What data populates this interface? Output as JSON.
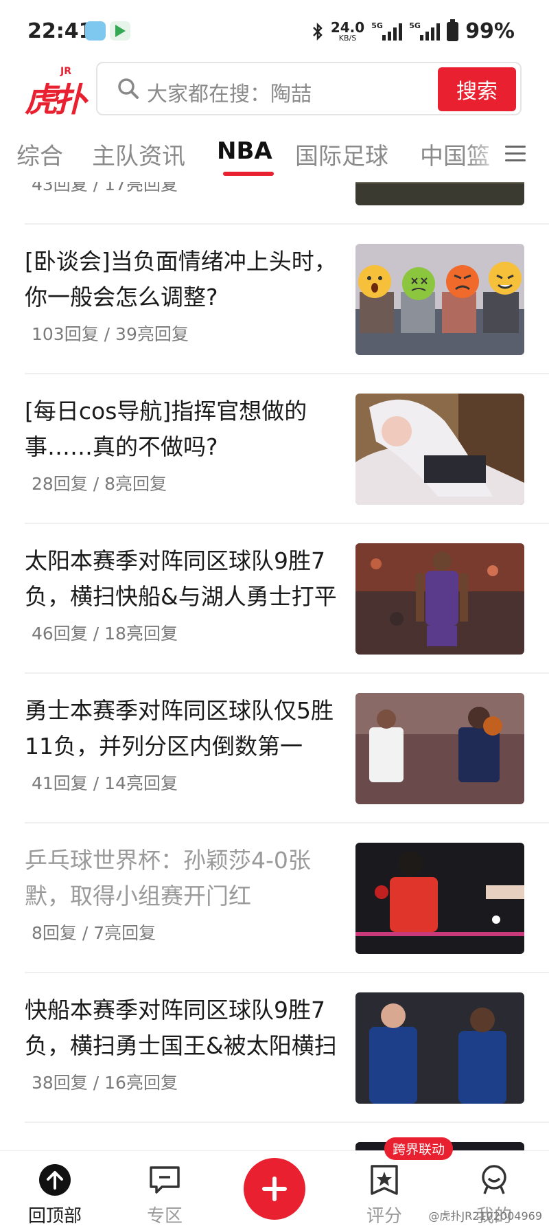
{
  "status_bar": {
    "time": "22:41",
    "net_speed_value": "24.0",
    "net_speed_unit": "KB/S",
    "sim1_label": "5G",
    "sim2_label": "5G",
    "battery": "99%"
  },
  "header": {
    "logo_text": "虎扑",
    "logo_sup": "JR",
    "search_placeholder": "大家都在搜：陶喆",
    "search_button": "搜索"
  },
  "tabs": [
    {
      "label": "综合",
      "active": false
    },
    {
      "label": "主队资讯",
      "active": false
    },
    {
      "label": "NBA",
      "active": true
    },
    {
      "label": "国际足球",
      "active": false
    },
    {
      "label": "中国篮",
      "active": false
    }
  ],
  "feed": {
    "partial_top": {
      "meta": "43回复 / 17亮回复"
    },
    "items": [
      {
        "title": "[卧谈会]当负面情绪冲上头时，你一般会怎么调整?",
        "meta": "103回复 / 39亮回复",
        "read": false,
        "thumb": "emoji-faces-image"
      },
      {
        "title": "[每日cos导航]指挥官想做的事……真的不做吗?",
        "meta": "28回复 / 8亮回复",
        "read": false,
        "thumb": "cosplay-image"
      },
      {
        "title": "太阳本赛季对阵同区球队9胜7负，横扫快船&与湖人勇士打平",
        "meta": "46回复 / 18亮回复",
        "read": false,
        "thumb": "suns-player-image"
      },
      {
        "title": "勇士本赛季对阵同区球队仅5胜11负，并列分区内倒数第一",
        "meta": "41回复 / 14亮回复",
        "read": false,
        "thumb": "warriors-clippers-image"
      },
      {
        "title": "乒乓球世界杯：孙颖莎4-0张默，取得小组赛开门红",
        "meta": "8回复 / 7亮回复",
        "read": true,
        "thumb": "table-tennis-image"
      },
      {
        "title": "快船本赛季对阵同区球队9胜7负，横扫勇士国王&被太阳横扫",
        "meta": "38回复 / 16亮回复",
        "read": false,
        "thumb": "clippers-players-image"
      }
    ]
  },
  "bottom_nav": {
    "items": [
      {
        "label": "回顶部",
        "icon": "arrow-up-circle-icon"
      },
      {
        "label": "专区",
        "icon": "chat-bubble-icon"
      },
      {
        "label": "评分",
        "icon": "star-badge-icon"
      },
      {
        "label": "我的",
        "icon": "profile-icon"
      }
    ],
    "fab_icon": "plus-icon",
    "promo_badge": "跨界联动"
  },
  "watermark": "@虎扑JR2102004969",
  "colors": {
    "accent": "#e8202f",
    "text": "#1a1a1a",
    "muted": "#8a8a8a"
  }
}
